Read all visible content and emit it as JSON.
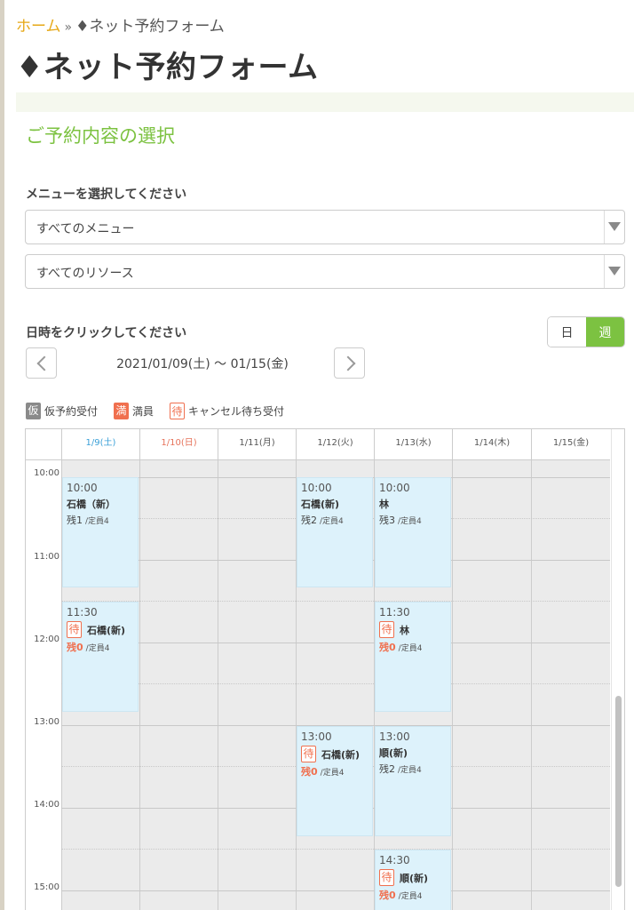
{
  "breadcrumb": {
    "home": "ホーム",
    "separator": "»",
    "current": "♦ネット予約フォーム"
  },
  "page_title": "♦ネット予約フォーム",
  "section_title": "ご予約内容の選択",
  "menu_label": "メニューを選択してください",
  "menu_select": {
    "value": "すべてのメニュー"
  },
  "resource_select": {
    "value": "すべてのリソース"
  },
  "datetime_label": "日時をクリックしてください",
  "view_toggle": {
    "day": "日",
    "week": "週",
    "active": "week"
  },
  "date_range": "2021/01/09(土) ～ 01/15(金)",
  "legend": [
    {
      "badge": "仮",
      "label": "仮予約受付"
    },
    {
      "badge": "満",
      "label": "満員"
    },
    {
      "badge": "待",
      "label": "キャンセル待ち受付"
    }
  ],
  "days": [
    "1/9(土)",
    "1/10(日)",
    "1/11(月)",
    "1/12(火)",
    "1/13(水)",
    "1/14(木)",
    "1/15(金)"
  ],
  "times": [
    "10:00",
    "11:00",
    "12:00",
    "13:00",
    "14:00",
    "15:00"
  ],
  "capacity_text": "/定員4",
  "slots": [
    {
      "time": "10:00",
      "name": "石橋（新）",
      "remain": "残1",
      "waitlist": false
    },
    {
      "time": "11:30",
      "name": "石橋(新)",
      "remain": "残0",
      "waitlist": true
    },
    {
      "time": "10:00",
      "name": "石橋(新)",
      "remain": "残2",
      "waitlist": false
    },
    {
      "time": "13:00",
      "name": "石橋(新)",
      "remain": "残0",
      "waitlist": true
    },
    {
      "time": "10:00",
      "name": "林",
      "remain": "残3",
      "waitlist": false
    },
    {
      "time": "11:30",
      "name": "林",
      "remain": "残0",
      "waitlist": true
    },
    {
      "time": "13:00",
      "name": "順(新)",
      "remain": "残2",
      "waitlist": false
    },
    {
      "time": "14:30",
      "name": "順(新)",
      "remain": "残0",
      "waitlist": true
    }
  ],
  "waitlist_badge": "待"
}
